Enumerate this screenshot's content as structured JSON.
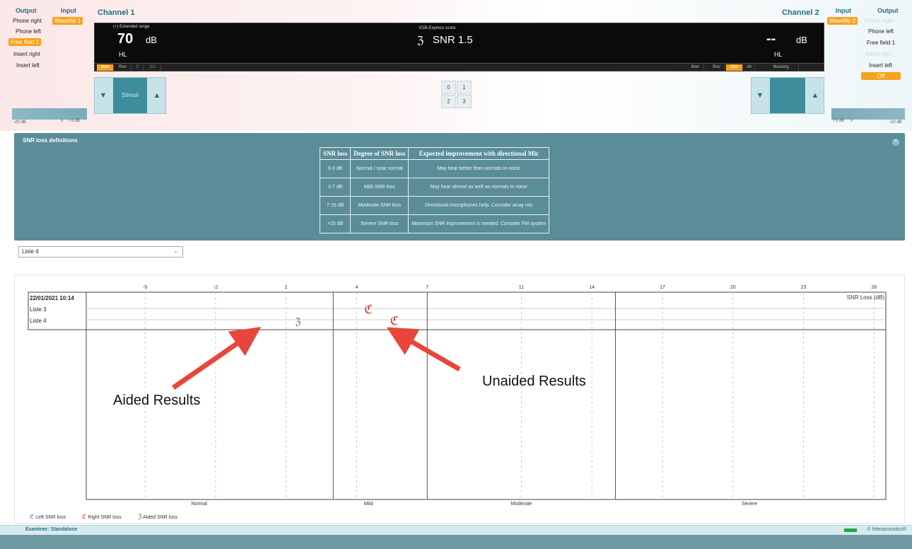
{
  "left_panel": {
    "output_header": "Output",
    "input_header": "Input",
    "output_items": [
      "Phone right",
      "Phone left",
      "Free field 1",
      "Insert right",
      "Insert left"
    ],
    "output_selected": "Free field 1",
    "input_selected": "Wavefile 1"
  },
  "right_panel": {
    "input_header": "Input",
    "output_header": "Output",
    "input_selected": "Wavefile 2",
    "output_items": [
      "Phone right",
      "Phone left",
      "Free field 1",
      "Insert right",
      "Insert left"
    ],
    "off_label": "Off"
  },
  "channel1": {
    "title": "Channel 1",
    "extended_range": "(+) Extended range",
    "level": "70",
    "unit": "dB",
    "hl": "HL",
    "stimuli_label": "Stimuli",
    "buttons": [
      "Man",
      "Rev",
      "⎍",
      "⎍⎍"
    ],
    "slider_min": "-20 dB",
    "slider_zero": "0",
    "slider_max": "+3 dB"
  },
  "center": {
    "score_label": "VDB-Express score",
    "score_value": "SNR 1.5",
    "num_buttons": [
      "0",
      "1",
      "2",
      "3"
    ]
  },
  "channel2": {
    "title": "Channel 2",
    "level": "--",
    "unit": "dB",
    "hl": "HL",
    "buttons": [
      "Man",
      "Rev",
      "Sim",
      "Alt",
      "Masking"
    ],
    "slider_min": "+3 dB",
    "slider_zero": "0",
    "slider_max": "-20 dB"
  },
  "snr_panel": {
    "title": "SNR loss definitions",
    "headers": [
      "SNR loss",
      "Degree of SNR loss",
      "Expected improvement with directional Mic"
    ],
    "rows": [
      [
        "0-3 dB",
        "Normal / near normal",
        "May hear better than normals in noise"
      ],
      [
        "3-7 dB",
        "Mild SNR loss",
        "May hear almost as well as normals in noise"
      ],
      [
        "7-15 dB",
        "Moderate SNR loss",
        "Directional microphones help. Consider array mic"
      ],
      [
        ">15 dB",
        "Severe SNR loss",
        "Maximum SNR improvement is needed. Consider FM system"
      ]
    ]
  },
  "list_select": {
    "value": "Liste 4"
  },
  "chart_data": {
    "type": "scatter",
    "x_ticks": [
      -5,
      -2,
      1,
      4,
      7,
      11,
      14,
      17,
      20,
      23,
      26
    ],
    "x_label": "SNR Loss (dB)",
    "xlim": [
      -7.5,
      26.5
    ],
    "session_label": "22/01/2021 10:14",
    "rows": [
      "Liste 3",
      "Liste 4"
    ],
    "boundaries": [
      3,
      7,
      15
    ],
    "regions": [
      {
        "label": "Normal",
        "center": -2.7
      },
      {
        "label": "Mild",
        "center": 4.5
      },
      {
        "label": "Moderate",
        "center": 11
      },
      {
        "label": "Severe",
        "center": 20.7
      }
    ],
    "points": [
      {
        "row": "Liste 4",
        "x": 1.5,
        "series": "Aided SNR loss"
      },
      {
        "row": "Liste 3",
        "x": 4.5,
        "series": "Right SNR loss"
      },
      {
        "row": "Liste 4",
        "x": 5.6,
        "series": "Right SNR loss"
      }
    ],
    "colors": {
      "aided": "#666666",
      "right": "#d0342c",
      "left": "#3a7bd5",
      "arrow": "#e8463c"
    }
  },
  "annotations": {
    "aided": "Aided Results",
    "unaided": "Unaided Results"
  },
  "legend": {
    "left": "Left SNR loss",
    "right": "Right SNR loss",
    "aided": "Aided SNR loss"
  },
  "status": {
    "examiner": "Examiner: Standalone",
    "brand": "© Interacoustics®"
  }
}
